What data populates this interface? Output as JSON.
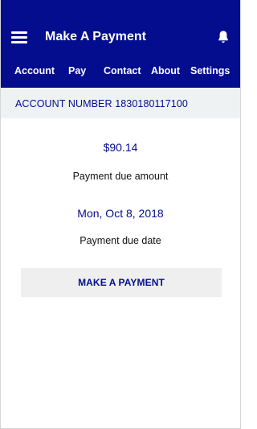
{
  "header": {
    "title": "Make A Payment",
    "menu_icon": "menu-icon",
    "notification_icon": "bell-icon",
    "background_color": "#030d8e"
  },
  "nav": {
    "tabs": [
      {
        "label": "Account",
        "active": false
      },
      {
        "label": "Pay",
        "active": true
      },
      {
        "label": "Contact",
        "active": false
      },
      {
        "label": "About",
        "active": false
      },
      {
        "label": "Settings",
        "active": false
      }
    ]
  },
  "account": {
    "number_text": "ACCOUNT NUMBER 1830180117100",
    "background_color": "#eef2f3"
  },
  "payment": {
    "amount": "$90.14",
    "amount_label": "Payment due amount",
    "due_date": "Mon, Oct 8, 2018",
    "due_date_label": "Payment due date",
    "button_label": "MAKE A PAYMENT"
  },
  "colors": {
    "accent": "#030d8e",
    "body_text": "#111111",
    "button_background": "#efefef"
  }
}
